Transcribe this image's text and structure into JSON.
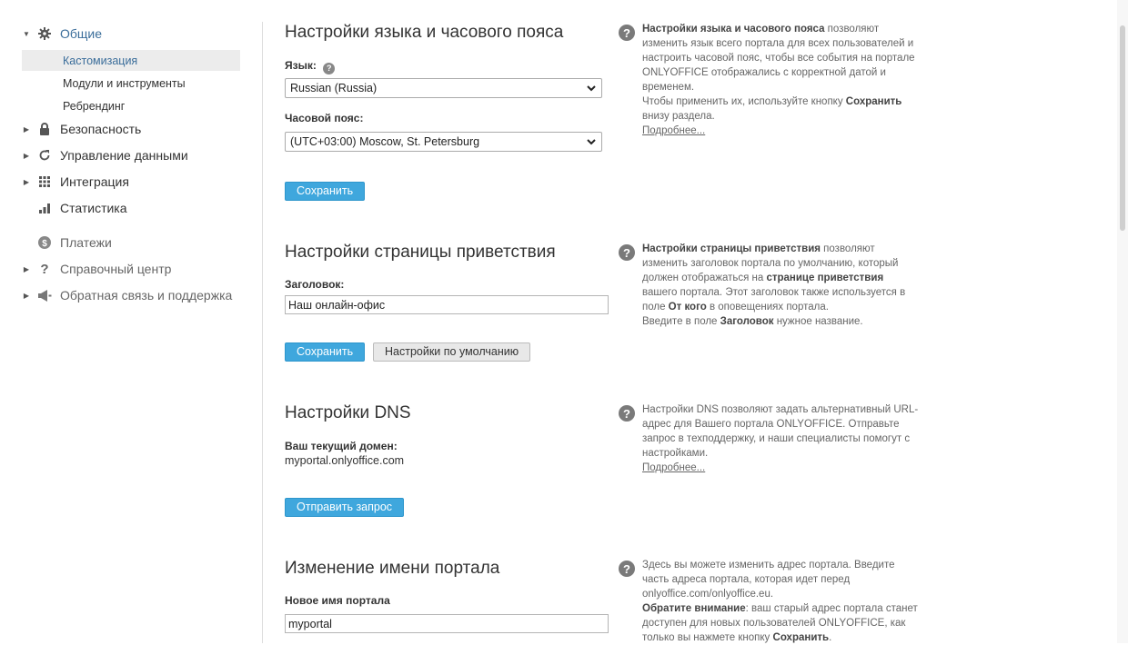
{
  "sidebar": {
    "groups": [
      {
        "label": "Общие",
        "icon": "gear-icon"
      },
      {
        "label": "Безопасность",
        "icon": "lock-icon"
      },
      {
        "label": "Управление данными",
        "icon": "refresh-icon"
      },
      {
        "label": "Интеграция",
        "icon": "grid-icon"
      },
      {
        "label": "Статистика",
        "icon": "bar-chart-icon"
      },
      {
        "label": "Платежи",
        "icon": "dollar-icon"
      },
      {
        "label": "Справочный центр",
        "icon": "question-icon"
      },
      {
        "label": "Обратная связь и поддержка",
        "icon": "megaphone-icon"
      }
    ],
    "sub_items": [
      {
        "label": "Кастомизация",
        "selected": true
      },
      {
        "label": "Модули и инструменты",
        "selected": false
      },
      {
        "label": "Ребрендинг",
        "selected": false
      }
    ]
  },
  "sections": {
    "language": {
      "title": "Настройки языка и часового пояса",
      "lang_label": "Язык:",
      "lang_value": "Russian (Russia)",
      "tz_label": "Часовой пояс:",
      "tz_value": "(UTC+03:00) Moscow, St. Petersburg",
      "save": "Сохранить",
      "help": {
        "bold1": "Настройки языка и часового пояса",
        "text1": " позволяют изменить язык всего портала для всех пользователей и настроить часовой пояс, чтобы все события на портале ONLYOFFICE отображались с корректной датой и временем.",
        "text2": "Чтобы применить их, используйте кнопку ",
        "bold2": "Сохранить",
        "text3": " внизу раздела.",
        "more": "Подробнее..."
      }
    },
    "welcome": {
      "title": "Настройки страницы приветствия",
      "header_label": "Заголовок:",
      "header_value": "Наш онлайн-офис",
      "save": "Сохранить",
      "defaults": "Настройки по умолчанию",
      "help": {
        "bold1": "Настройки страницы приветствия",
        "text1": " позволяют изменить заголовок портала по умолчанию, который должен отображаться на ",
        "bold2": "странице приветствия",
        "text2": " вашего портала. Этот заголовок также используется в поле ",
        "bold3": "От кого",
        "text3": " в оповещениях портала.",
        "text4": "Введите в поле ",
        "bold4": "Заголовок",
        "text5": " нужное название."
      }
    },
    "dns": {
      "title": "Настройки DNS",
      "domain_label": "Ваш текущий домен:",
      "domain_value": "myportal.onlyoffice.com",
      "send": "Отправить запрос",
      "help": {
        "text1": "Настройки DNS позволяют задать альтернативный URL-адрес для Вашего портала ONLYOFFICE. Отправьте запрос в техподдержку, и наши специалисты помогут с настройками.",
        "more": "Подробнее..."
      }
    },
    "rename": {
      "title": "Изменение имени портала",
      "name_label": "Новое имя портала",
      "name_value": "myportal",
      "help": {
        "text1": "Здесь вы можете изменить адрес портала. Введите часть адреса портала, которая идет перед onlyoffice.com/onlyoffice.eu.",
        "bold1": "Обратите внимание",
        "text2": ": ваш старый адрес портала станет доступен для новых пользователей ONLYOFFICE, как только вы нажмете кнопку ",
        "bold2": "Сохранить",
        "text3": "."
      }
    }
  },
  "colors": {
    "accent": "#3fa7dd",
    "link": "#3a6d9a",
    "selected_bg": "#ececec"
  }
}
